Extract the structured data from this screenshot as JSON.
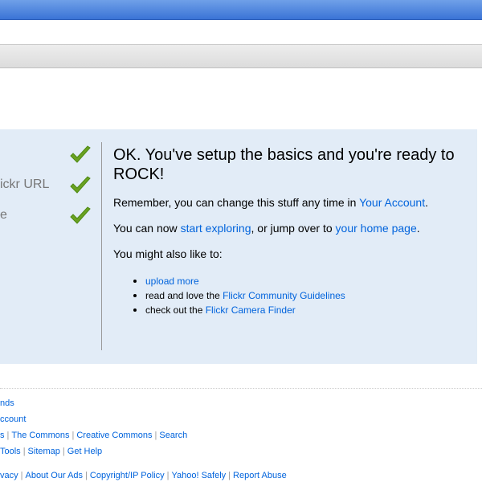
{
  "steps": [
    {
      "label": "",
      "checked": true
    },
    {
      "label": "ickr URL",
      "checked": true
    },
    {
      "label": "e",
      "checked": true
    }
  ],
  "main": {
    "heading": "OK. You've setup the basics and you're ready to ROCK!",
    "remember_text": "Remember, you can change this stuff any time in ",
    "your_account_link": "Your Account",
    "period": ".",
    "now_text": "You can now ",
    "start_exploring_link": "start exploring",
    "jump_text": ", or jump over to ",
    "home_page_link": "your home page",
    "might_like": "You might also like to:",
    "suggestions": [
      {
        "prefix": "",
        "link": "upload more"
      },
      {
        "prefix": "read and love the ",
        "link": "Flickr Community Guidelines"
      },
      {
        "prefix": "check out the ",
        "link": "Flickr Camera Finder"
      }
    ]
  },
  "footer": {
    "row1": [
      "nds"
    ],
    "row2": [
      "ccount"
    ],
    "row3": [
      "s",
      "The Commons",
      "Creative Commons",
      "Search"
    ],
    "row4": [
      "Tools",
      "Sitemap",
      "Get Help"
    ],
    "row5": [
      "vacy",
      "About Our Ads",
      "Copyright/IP Policy",
      "Yahoo! Safely",
      "Report Abuse"
    ]
  },
  "colors": {
    "link": "#0063dc",
    "panel": "#e2ecf7",
    "check": "#6aa121"
  }
}
